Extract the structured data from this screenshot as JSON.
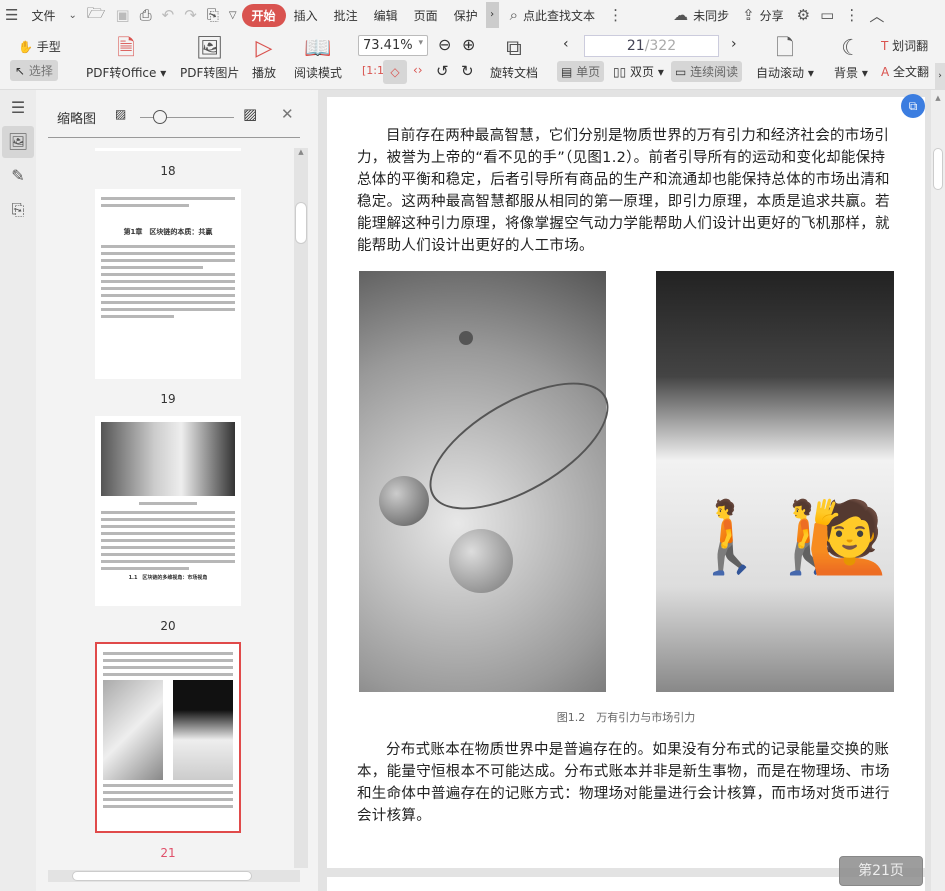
{
  "menubar": {
    "file": "文件",
    "tabs": [
      "开始",
      "插入",
      "批注",
      "编辑",
      "页面",
      "保护"
    ],
    "search_placeholder": "点此查找文本",
    "sync": "未同步",
    "share": "分享"
  },
  "toolbar": {
    "hand": "手型",
    "select": "选择",
    "pdf_office": "PDF转Office",
    "pdf_image": "PDF转图片",
    "play": "播放",
    "read_mode": "阅读模式",
    "zoom": "73.41%",
    "rotate": "旋转文档",
    "page_current": "21",
    "page_total": "/322",
    "single": "单页",
    "double": "双页",
    "continuous": "连续阅读",
    "auto_scroll": "自动滚动",
    "background": "背景",
    "word_translate": "划词翻",
    "full_translate": "全文翻"
  },
  "panel": {
    "title": "缩略图",
    "thumbs": [
      {
        "num": "18"
      },
      {
        "num": "19"
      },
      {
        "num": "20"
      },
      {
        "num": "21"
      }
    ],
    "thumb18_heading": "第1章　区块链的本质：共赢",
    "thumb20_heading": "1.1　区块链的多维视角：市场视角"
  },
  "page": {
    "para1": "目前存在两种最高智慧，它们分别是物质世界的万有引力和经济社会的市场引力，被誉为上帝的“看不见的手”（见图1.2）。前者引导所有的运动和变化却能保持总体的平衡和稳定，后者引导所有商品的生产和流通却也能保持总体的市场出清和稳定。这两种最高智慧都服从相同的第一原理，即引力原理，本质是追求共赢。若能理解这种引力原理，将像掌握空气动力学能帮助人们设计出更好的飞机那样，就能帮助人们设计出更好的人工市场。",
    "caption": "图1.2　万有引力与市场引力",
    "para2": "分布式账本在物质世界中是普遍存在的。如果没有分布式的记录能量交换的账本，能量守恒根本不可能达成。分布式账本并非是新生事物，而是在物理场、市场和生命体中普遍存在的记账方式：物理场对能量进行会计核算，而市场对货币进行会计核算。",
    "page_badge": "第21页"
  },
  "colors": {
    "accent": "#d9534f",
    "selected_thumb": "#e04a4a"
  }
}
